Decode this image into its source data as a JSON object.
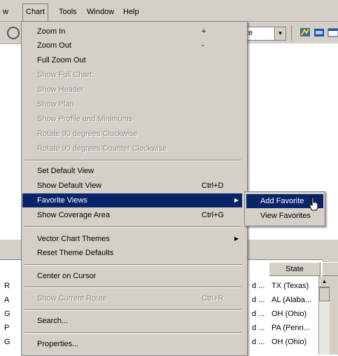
{
  "menubar": {
    "items": [
      {
        "label": "w"
      },
      {
        "label": "Chart"
      },
      {
        "label": "Tools"
      },
      {
        "label": "Window"
      },
      {
        "label": "Help"
      }
    ]
  },
  "toolbar": {
    "combo_value": "te",
    "icons": [
      "route-icon",
      "chart-icon",
      "window-icon"
    ]
  },
  "chart_menu": {
    "items": [
      {
        "label": "Zoom In",
        "shortcut": "+",
        "enabled": true
      },
      {
        "label": "Zoom Out",
        "shortcut": "-",
        "enabled": true
      },
      {
        "label": "Full Zoom Out",
        "shortcut": "",
        "enabled": true
      },
      {
        "label": "Show Full Chart",
        "shortcut": "",
        "enabled": false
      },
      {
        "label": "Show Header",
        "shortcut": "",
        "enabled": false
      },
      {
        "label": "Show Plan",
        "shortcut": "",
        "enabled": false
      },
      {
        "label": "Show Profile and Minimums",
        "shortcut": "",
        "enabled": false
      },
      {
        "label": "Rotate 90 degrees Clockwise",
        "shortcut": "",
        "enabled": false
      },
      {
        "label": "Rotate 90 degrees Counter Clockwise",
        "shortcut": "",
        "enabled": false
      },
      {
        "label": "Set Default View",
        "shortcut": "",
        "enabled": true
      },
      {
        "label": "Show Default View",
        "shortcut": "Ctrl+D",
        "enabled": true
      },
      {
        "label": "Favorite Views",
        "shortcut": "",
        "enabled": true,
        "submenu": true,
        "highlighted": true
      },
      {
        "label": "Show Coverage Area",
        "shortcut": "Ctrl+G",
        "enabled": true
      },
      {
        "label": "Vector Chart Themes",
        "shortcut": "",
        "enabled": true,
        "submenu": true
      },
      {
        "label": "Reset Theme Defaults",
        "shortcut": "",
        "enabled": true
      },
      {
        "label": "Center on Cursor",
        "shortcut": "",
        "enabled": true
      },
      {
        "label": "Show Current Route",
        "shortcut": "Ctrl+R",
        "enabled": false
      },
      {
        "label": "Search...",
        "shortcut": "",
        "enabled": true
      },
      {
        "label": "Properties...",
        "shortcut": "",
        "enabled": true
      }
    ]
  },
  "favorite_submenu": {
    "items": [
      {
        "label": "Add Favorite",
        "highlighted": true
      },
      {
        "label": "View Favorites"
      }
    ]
  },
  "grid": {
    "header_state": "State",
    "rows": [
      {
        "c1": "R",
        "c2": "d ...",
        "state": "TX (Texas)"
      },
      {
        "c1": "A",
        "c2": "d ...",
        "state": "AL (Alaba..."
      },
      {
        "c1": "G",
        "c2": "d ...",
        "state": "OH (Ohio)"
      },
      {
        "c1": "P",
        "c2": "d ...",
        "state": "PA (Penn..."
      },
      {
        "c1": "G",
        "c2": "d ...",
        "state": "OH (Ohio)"
      }
    ]
  }
}
